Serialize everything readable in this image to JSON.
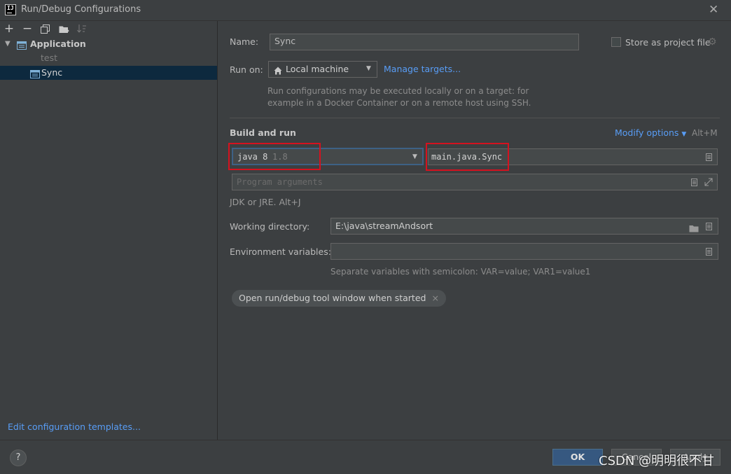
{
  "window": {
    "title": "Run/Debug Configurations",
    "app_icon": "IJ"
  },
  "left": {
    "toolbar": [
      "add-icon",
      "remove-icon",
      "copy-icon",
      "move-to-folder-icon",
      "sort-icon"
    ],
    "tree": {
      "group": "Application",
      "items": [
        {
          "label": "test",
          "selected": false
        },
        {
          "label": "Sync",
          "selected": true
        }
      ]
    },
    "footer_link": "Edit configuration templates..."
  },
  "config": {
    "name_label": "Name:",
    "name_value": "Sync",
    "store_label": "Store as project file",
    "store_checked": false,
    "run_on_label": "Run on:",
    "run_on_value": "Local machine",
    "manage_targets": "Manage targets...",
    "run_on_hint_1": "Run configurations may be executed locally or on a target: for",
    "run_on_hint_2": "example in a Docker Container or on a remote host using SSH.",
    "build_title": "Build and run",
    "modify_options": "Modify options",
    "modify_shortcut": "Alt+M",
    "jdk_name": "java 8",
    "jdk_version": "1.8",
    "main_class": "main.java.Sync",
    "program_args_placeholder": "Program arguments",
    "jdk_hint": "JDK or JRE. Alt+J",
    "workdir_label": "Working directory:",
    "workdir_value": "E:\\java\\streamAndsort",
    "env_label": "Environment variables:",
    "env_value": "",
    "env_hint": "Separate variables with semicolon: VAR=value; VAR1=value1",
    "chip_label": "Open run/debug tool window when started"
  },
  "buttons": {
    "help": "?",
    "ok": "OK",
    "cancel": "Cancel",
    "apply": "Apply"
  },
  "watermark": "CSDN @明明很不甘",
  "colors": {
    "accent": "#589df6",
    "highlight_box": "#d5121f",
    "selection": "#0d293e"
  }
}
